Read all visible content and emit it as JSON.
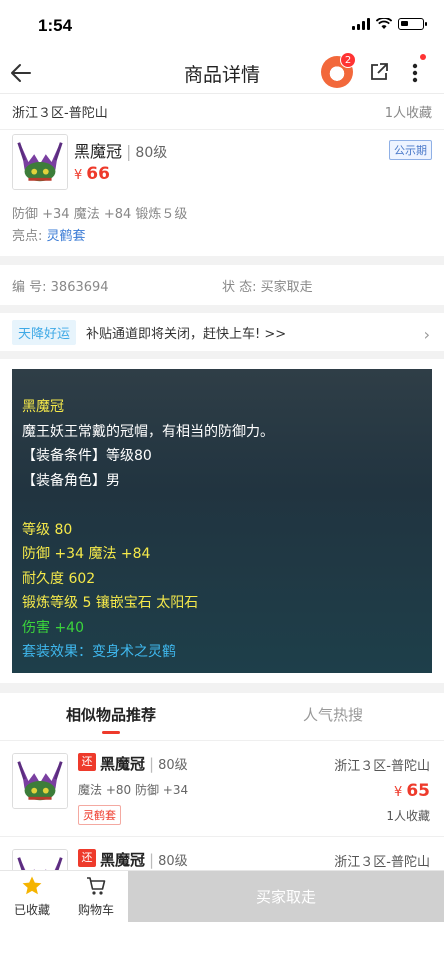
{
  "status_bar": {
    "time": "1:54"
  },
  "nav": {
    "title": "商品详情",
    "badge_count": "2"
  },
  "item": {
    "server": "浙江３区-普陀山",
    "favorites": "1人收藏",
    "name": "黑魔冠",
    "level": "80级",
    "price_symbol": "¥",
    "price": "66",
    "status_tag": "公示期",
    "attrs": "防御 +34 魔法 +84 锻炼５级",
    "highlight_label": "亮点:",
    "highlight_value": "灵鹤套"
  },
  "meta": {
    "serial_label": "编 号:",
    "serial_value": "3863694",
    "state_label": "状 态:",
    "state_value": "买家取走"
  },
  "banner": {
    "tag": "天降好运",
    "text": "补贴通道即将关闭，赶快上车! >>"
  },
  "tooltip": {
    "name": "黑魔冠",
    "desc": "魔王妖王常戴的冠帽，有相当的防御力。",
    "req_level": "【装备条件】等级80",
    "req_role": "【装备角色】男",
    "level": "等级 80",
    "stats": "防御 +34 魔法 +84",
    "durability": "耐久度 602",
    "forge": "锻炼等级 5 镶嵌宝石 太阳石",
    "damage": "伤害 +40",
    "set_effect": "套装效果：变身术之灵鹤"
  },
  "tabs": [
    "相似物品推荐",
    "人气热搜"
  ],
  "similar": [
    {
      "tag": "还",
      "name": "黑魔冠",
      "level": "80级",
      "attrs": "魔法 +80 防御 +34",
      "set": "灵鹤套",
      "server": "浙江３区-普陀山",
      "price": "65",
      "favorites": "1人收藏"
    },
    {
      "tag": "还",
      "name": "黑魔冠",
      "level": "80级",
      "server": "浙江３区-普陀山"
    }
  ],
  "bottom": {
    "fav_label": "已收藏",
    "cart_label": "购物车",
    "buy_label": "买家取走"
  },
  "colors": {
    "accent": "#ee3a2b",
    "tooltip_yellow": "#f5e94a",
    "tooltip_green": "#3bd53b",
    "tooltip_blue": "#3fb8ee"
  }
}
